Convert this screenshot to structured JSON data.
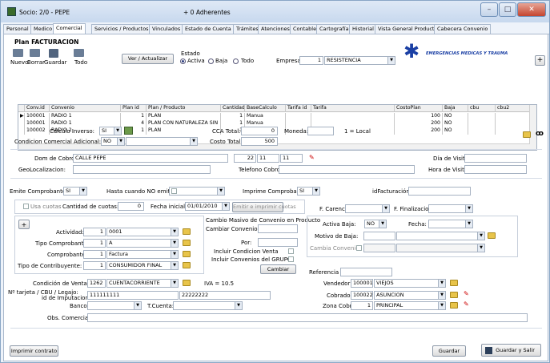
{
  "titlebar": {
    "title": "Socio: 2/0 - PEPE",
    "subtitle": "+ 0 Adherentes",
    "min": "–",
    "max": "□",
    "close": "✕"
  },
  "tabs": [
    "Personal",
    "Medico",
    "Comercial",
    "Servicios / Productos",
    "Vinculados",
    "Estado de Cuenta",
    "Trámites",
    "Atenciones",
    "Contable",
    "Cartografía",
    "Historial",
    "Vista General Productos",
    "Cabecera Convenio"
  ],
  "plan": {
    "heading": "Plan FACTURACION",
    "nuevo": "Nuevo",
    "borrar": "Borrar",
    "guardar": "Guardar",
    "todo": "Todo",
    "ver_actualizar": "Ver / Actualizar",
    "estado_label": "Estado",
    "activa": "Activa",
    "baja": "Baja",
    "todo_radio": "Todo",
    "empresa_label": "Empresa:",
    "empresa_num": "1",
    "empresa_val": "RESISTENCIA",
    "logo_text": "EMERGENCIAS MEDICAS Y TRAUMA",
    "add": "+"
  },
  "grid": {
    "headers": [
      "Conv.id",
      "Convenio",
      "Plan id",
      "Plan / Producto",
      "Cantidad",
      "BaseCalculo",
      "Tarifa id",
      "Tarifa",
      "CostoPlan",
      "Baja",
      "cbu",
      "cbu2"
    ],
    "rows": [
      [
        "100001",
        "RADIO 1",
        "1",
        "PLAN",
        "1",
        "Manua",
        "",
        "",
        "100",
        "NO",
        "",
        ""
      ],
      [
        "100001",
        "RADIO 1",
        "4",
        "PLAN CON NATURALEZA SIN",
        "1",
        "Manua",
        "",
        "",
        "200",
        "NO",
        "",
        ""
      ],
      [
        "100002",
        "RADIO 2",
        "1",
        "PLAN",
        "1",
        "Manua",
        "",
        "",
        "200",
        "NO",
        "",
        ""
      ]
    ]
  },
  "calc": {
    "inverso_label": "Calculo Inverso:",
    "inverso_val": "SI",
    "cond_label": "Condicion Comercial Adicional:",
    "cond_val": "NO",
    "cca_label": "CCA Total:",
    "cca_val": "0",
    "moneda_label": "Moneda:",
    "local": "1 = Local",
    "costo_label": "Costo Total:",
    "costo_val": "500"
  },
  "cobro": {
    "dom_label": "Dom de Cobro:",
    "dom_val": "CALLE PEPE",
    "n1": "22",
    "n2": "11",
    "n3": "11",
    "dia_label": "Día de Visita:",
    "geo_label": "GeoLocalizacion:",
    "tel_label": "Telefono Cobro:",
    "hora_label": "Hora de Visita:"
  },
  "comp": {
    "emite_label": "Emite Comprobante:",
    "emite_val": "SI",
    "hasta_label": "Hasta cuando NO emite:",
    "imprime_label": "Imprime Comprobante:",
    "imprime_val": "SI",
    "idfac_label": "idFacturación:"
  },
  "cuotas": {
    "usa": "Usa cuotas",
    "cant_label": "Cantidad de cuotas:",
    "cant_val": "0",
    "fecha_label": "Fecha inicial",
    "fecha_val": "01/01/2010",
    "emitir": "Emitir e imprimir cuotas",
    "carencia": "F. Carencia:",
    "finaliz": "F. Finalizacion:"
  },
  "act": {
    "plus": "+",
    "actividad_label": "Actividad:",
    "actividad_num": "1",
    "actividad_val": "0001",
    "tipo_label": "Tipo Comprobante:",
    "tipo_num": "1",
    "tipo_val": "A",
    "comp_label": "Comprobante:",
    "comp_num": "1",
    "comp_val": "Factura",
    "contrib_label": "Tipo de Contribuyente:",
    "contrib_num": "1",
    "contrib_val": "CONSUMIDOR FINAL"
  },
  "masivo": {
    "title": "Cambio Masivo de Convenio en Producto",
    "cambiar_label": "Cambiar Convenio:",
    "por_label": "Por:",
    "incl1": "Incluir Condicion Venta",
    "incl2": "Incluir Convenios del GRUPO",
    "cambiar_btn": "Cambiar"
  },
  "baja": {
    "activa_label": "Activa Baja:",
    "activa_val": "NO",
    "fecha_label": "Fecha:",
    "motivo_label": "Motivo de Baja:",
    "cambia_label": "Cambia Convenio:"
  },
  "venta": {
    "cond_label": "Condición de Venta:",
    "cond_num": "1262",
    "cond_val": "CUENTACORRIENTE",
    "iva": "IVA = 10.5",
    "ref_label": "Referencia Alta:",
    "tarjeta_label": "Nº tarjeta / CBU / Legajo:",
    "imput_label": "id de Imputacion",
    "tarjeta_val": "111111111",
    "tarjeta2": "22222222",
    "banco_label": "Banco:",
    "tcuenta_label": "T.Cuenta:",
    "obs_label": "Obs. Comercial:",
    "vend_label": "Vendedor:",
    "vend_num": "100001",
    "vend_val": "VIEJOS",
    "cob_label": "Cobrador:",
    "cob_num": "100022",
    "cob_val": "ASUNCION",
    "zona_label": "Zona Cobro:",
    "zona_num": "1",
    "zona_val": "PRINCIPAL"
  },
  "footer": {
    "imprimir": "Imprimir contrato",
    "guardar": "Guardar",
    "guardar_salir": "Guardar y Salir"
  }
}
